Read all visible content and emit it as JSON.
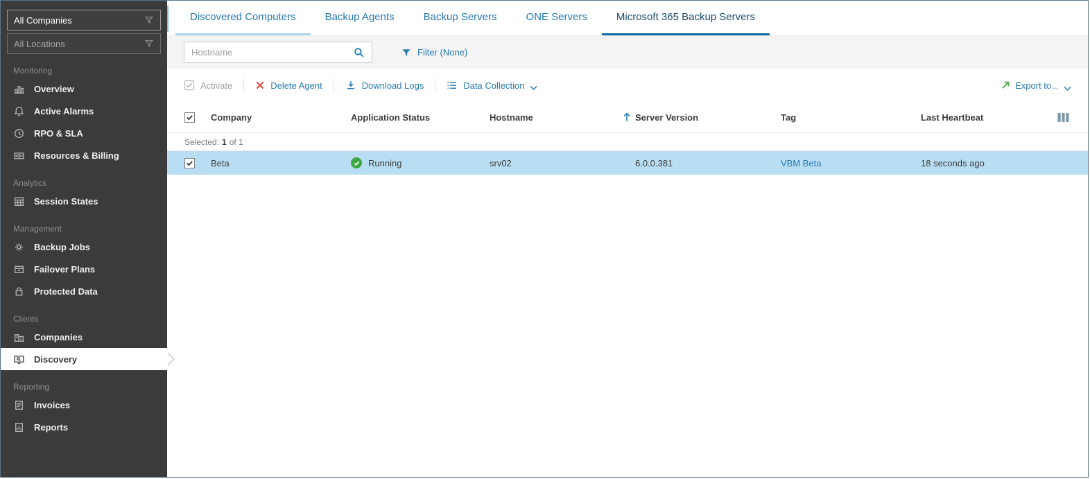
{
  "sidebar": {
    "filters": [
      {
        "value": "All Companies",
        "icon": "filter-funnel-icon"
      },
      {
        "value": "All Locations",
        "icon": "filter-funnel-icon"
      }
    ],
    "sections": [
      {
        "label": "Monitoring",
        "items": [
          {
            "label": "Overview",
            "icon": "overview-icon"
          },
          {
            "label": "Active Alarms",
            "icon": "alarms-icon"
          },
          {
            "label": "RPO & SLA",
            "icon": "rpo-sla-icon"
          },
          {
            "label": "Resources & Billing",
            "icon": "billing-icon"
          }
        ]
      },
      {
        "label": "Analytics",
        "items": [
          {
            "label": "Session States",
            "icon": "session-states-icon"
          }
        ]
      },
      {
        "label": "Management",
        "items": [
          {
            "label": "Backup Jobs",
            "icon": "backup-jobs-icon"
          },
          {
            "label": "Failover Plans",
            "icon": "failover-plans-icon"
          },
          {
            "label": "Protected Data",
            "icon": "protected-data-icon"
          }
        ]
      },
      {
        "label": "Clients",
        "items": [
          {
            "label": "Companies",
            "icon": "companies-icon"
          },
          {
            "label": "Discovery",
            "icon": "discovery-icon",
            "active": true
          }
        ]
      },
      {
        "label": "Reporting",
        "items": [
          {
            "label": "Invoices",
            "icon": "invoices-icon"
          },
          {
            "label": "Reports",
            "icon": "reports-icon"
          }
        ]
      }
    ]
  },
  "tabs": [
    {
      "label": "Discovered Computers"
    },
    {
      "label": "Backup Agents"
    },
    {
      "label": "Backup Servers"
    },
    {
      "label": "ONE Servers"
    },
    {
      "label": "Microsoft 365 Backup Servers",
      "active": true
    }
  ],
  "filter_bar": {
    "search_placeholder": "Hostname",
    "search_icon": "magnifier-icon",
    "filter_label": "Filter (None)",
    "filter_icon": "funnel-icon"
  },
  "toolbar": {
    "activate_label": "Activate",
    "delete_label": "Delete Agent",
    "download_label": "Download Logs",
    "data_collection_label": "Data Collection",
    "export_label": "Export to...",
    "icons": [
      "checkbox-icon",
      "red-x-icon",
      "download-icon",
      "data-collection-icon",
      "export-arrow-icon",
      "chevron-down-icon"
    ]
  },
  "table": {
    "columns": [
      "Company",
      "Application Status",
      "Hostname",
      "Server Version",
      "Tag",
      "Last Heartbeat"
    ],
    "sort": {
      "column": "Server Version",
      "direction": "asc",
      "icon": "sort-up-arrow-icon"
    },
    "selected": {
      "label": "Selected:",
      "count": "1",
      "total": "of 1"
    },
    "rows": [
      {
        "checked": true,
        "company": "Beta",
        "status": "Running",
        "status_icon": "green-check-circle-icon",
        "hostname": "srv02",
        "server_version": "6.0.0.381",
        "tag": "VBM Beta",
        "last_heartbeat": "18 seconds ago"
      }
    ]
  },
  "colors": {
    "accent_blue": "#2779b0",
    "active_tab_underline": "#0c6ca6",
    "green": "#3ea644",
    "export_green": "#4aa546",
    "red": "#d9453c",
    "selected_row": "#b9def4",
    "sidebar_bg": "#3b3b3b"
  }
}
